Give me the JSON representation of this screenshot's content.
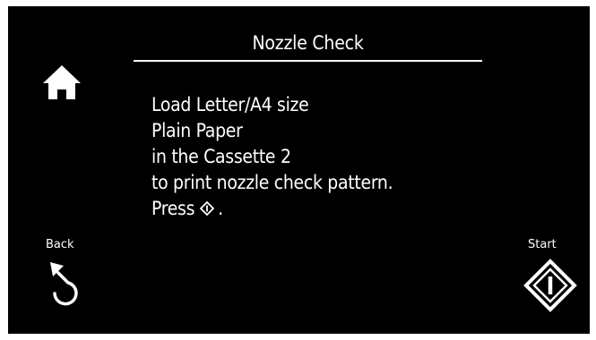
{
  "screen": {
    "title": "Nozzle Check"
  },
  "message": {
    "lines": [
      "Load Letter/A4 size",
      "Plain Paper",
      "in the Cassette 2",
      "to print nozzle check pattern."
    ],
    "press_prefix": "Press",
    "press_suffix": ".",
    "press_icon": "start-icon"
  },
  "buttons": {
    "home_icon": "home-icon",
    "back_label": "Back",
    "back_icon": "back-arrow-icon",
    "start_label": "Start",
    "start_icon": "start-icon"
  },
  "colors": {
    "screen_background": "#000000",
    "foreground": "#ffffff",
    "bezel": "#ffffff"
  }
}
